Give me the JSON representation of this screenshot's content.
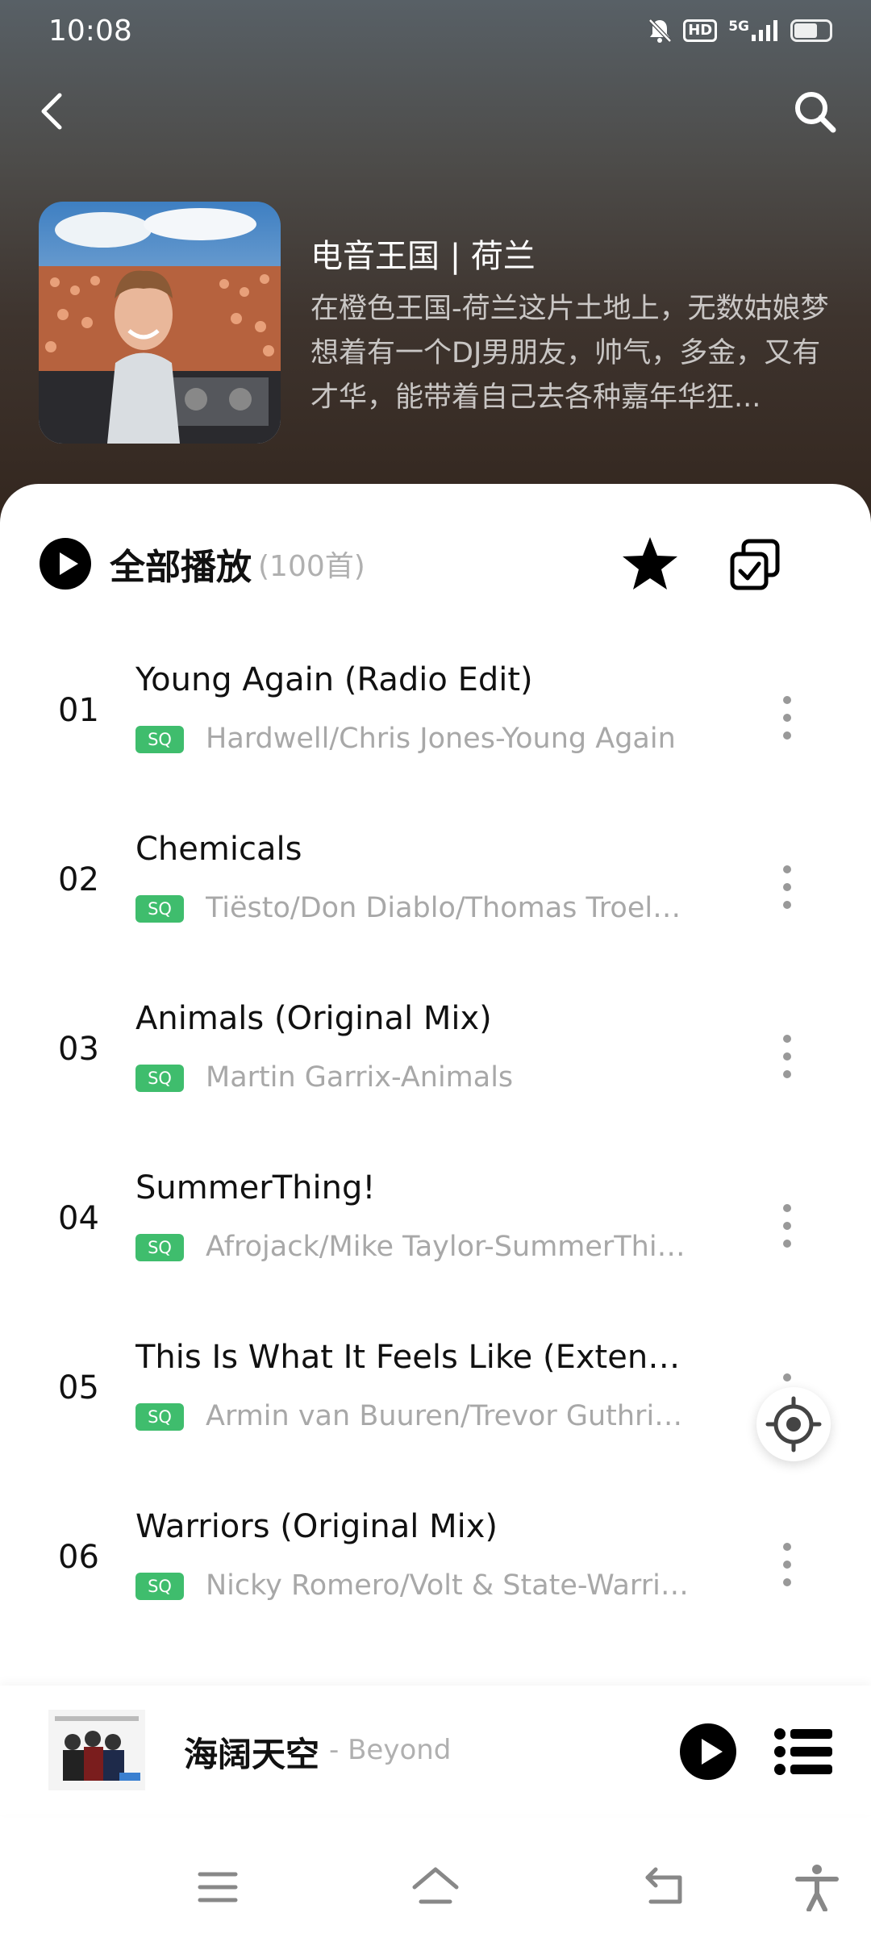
{
  "status_bar": {
    "time": "10:08",
    "hd_label": "HD",
    "network_label": "5G",
    "icons": [
      "bell-muted-icon",
      "hd-icon",
      "signal-5g-icon",
      "battery-icon"
    ]
  },
  "nav": {
    "back_icon": "chevron-left-icon",
    "search_icon": "search-icon"
  },
  "album": {
    "title": "电音王国 | 荷兰",
    "description": "在橙色王国-荷兰这片土地上，无数姑娘梦想着有一个DJ男朋友，帅气，多金，又有才华，能带着自己去各种嘉年华狂..."
  },
  "playall": {
    "label": "全部播放",
    "count": "(100首)",
    "icons": [
      "play-circle-icon",
      "star-icon",
      "multi-select-icon"
    ]
  },
  "songs": [
    {
      "num": "01",
      "title": "Young Again (Radio Edit)",
      "badge": "SQ",
      "artist": "Hardwell/Chris Jones-Young Again"
    },
    {
      "num": "02",
      "title": "Chemicals",
      "badge": "SQ",
      "artist": "Tiësto/Don Diablo/Thomas Troelsen-Chemicals"
    },
    {
      "num": "03",
      "title": "Animals (Original Mix)",
      "badge": "SQ",
      "artist": "Martin Garrix-Animals"
    },
    {
      "num": "04",
      "title": "SummerThing!",
      "badge": "SQ",
      "artist": "Afrojack/Mike Taylor-SummerThing!"
    },
    {
      "num": "05",
      "title": "This Is What It Feels Like (Extended Mix)",
      "badge": "SQ",
      "artist": "Armin van Buuren/Trevor Guthrie-This Is What It Feels Like"
    },
    {
      "num": "06",
      "title": "Warriors (Original Mix)",
      "badge": "SQ",
      "artist": "Nicky Romero/Volt & State-Warriors"
    }
  ],
  "player": {
    "title": "海阔天空",
    "artist": "- Beyond",
    "icons": [
      "play-icon",
      "playlist-icon"
    ]
  },
  "system_nav": {
    "icons": [
      "menu-icon",
      "home-icon",
      "back-icon",
      "accessibility-icon"
    ]
  },
  "colors": {
    "accent_green": "#3fbd6d",
    "text_primary": "#111111",
    "text_secondary": "#a8a8a8"
  }
}
